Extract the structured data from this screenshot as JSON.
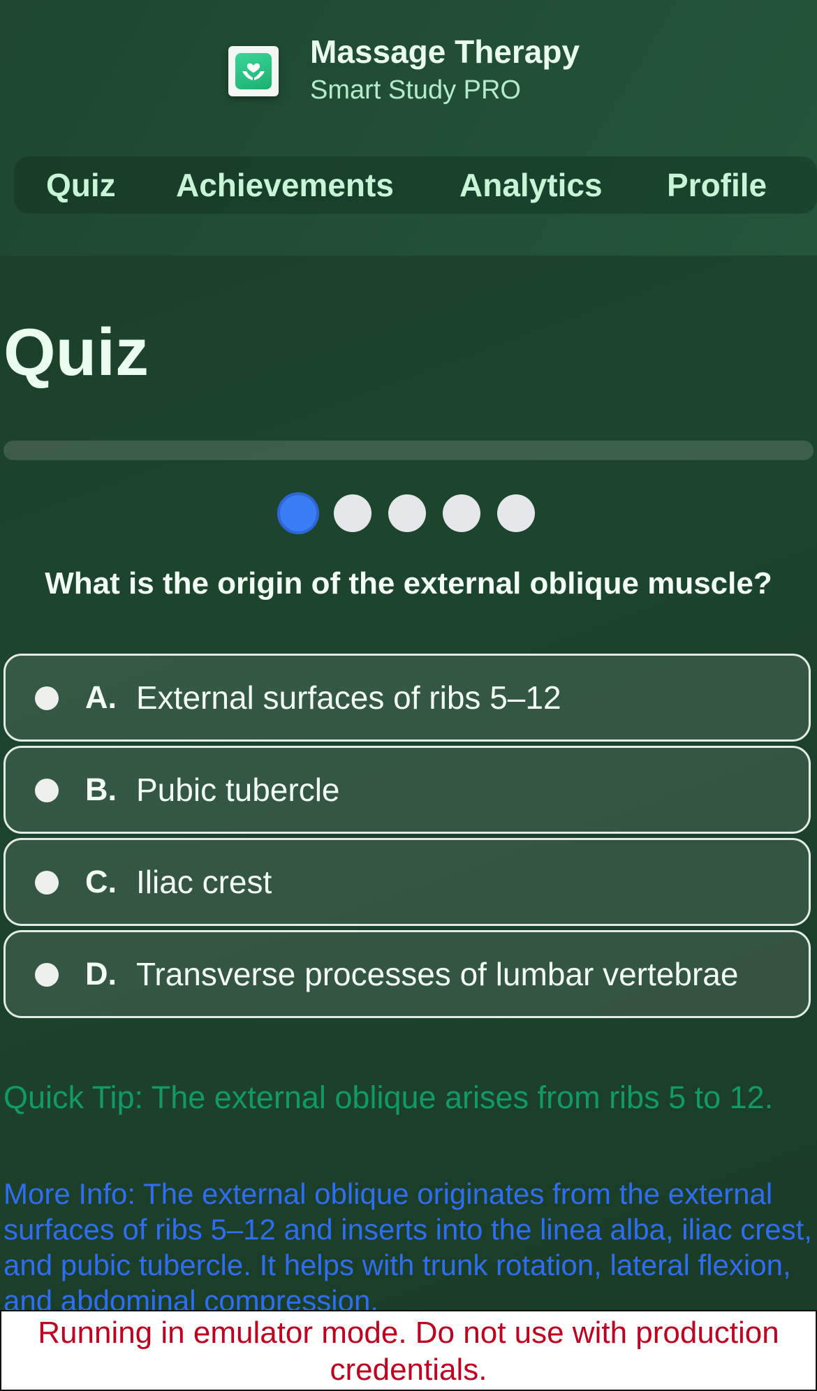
{
  "app": {
    "title": "Massage Therapy",
    "subtitle": "Smart Study PRO"
  },
  "nav": {
    "items": [
      {
        "label": "Quiz"
      },
      {
        "label": "Achievements"
      },
      {
        "label": "Analytics"
      },
      {
        "label": "Profile"
      }
    ]
  },
  "quiz": {
    "heading": "Quiz",
    "progress_fraction": 0,
    "total_questions": 5,
    "current_question_index": 0,
    "question": "What is the origin of the external oblique muscle?",
    "options": [
      {
        "letter": "A.",
        "text": "External surfaces of ribs 5–12"
      },
      {
        "letter": "B.",
        "text": "Pubic tubercle"
      },
      {
        "letter": "C.",
        "text": "Iliac crest"
      },
      {
        "letter": "D.",
        "text": "Transverse processes of lumbar vertebrae"
      }
    ],
    "tip": "Quick Tip: The external oblique arises from ribs 5 to 12.",
    "more_info": "More Info: The external oblique originates from the external surfaces of ribs 5–12 and inserts into the linea alba, iliac crest, and pubic tubercle. It helps with trunk rotation, lateral flexion, and abdominal compression."
  },
  "banner": {
    "text": "Running in emulator mode. Do not use with production credentials."
  },
  "colors": {
    "background": "#1d452e",
    "tip": "#119a66",
    "more_info": "#2f6ef2",
    "dot_active": "#3a7df5",
    "dot_inactive": "#e6e7ea",
    "banner_text": "#c1001f"
  },
  "icons": {
    "app_icon": "hands-heart-icon"
  }
}
